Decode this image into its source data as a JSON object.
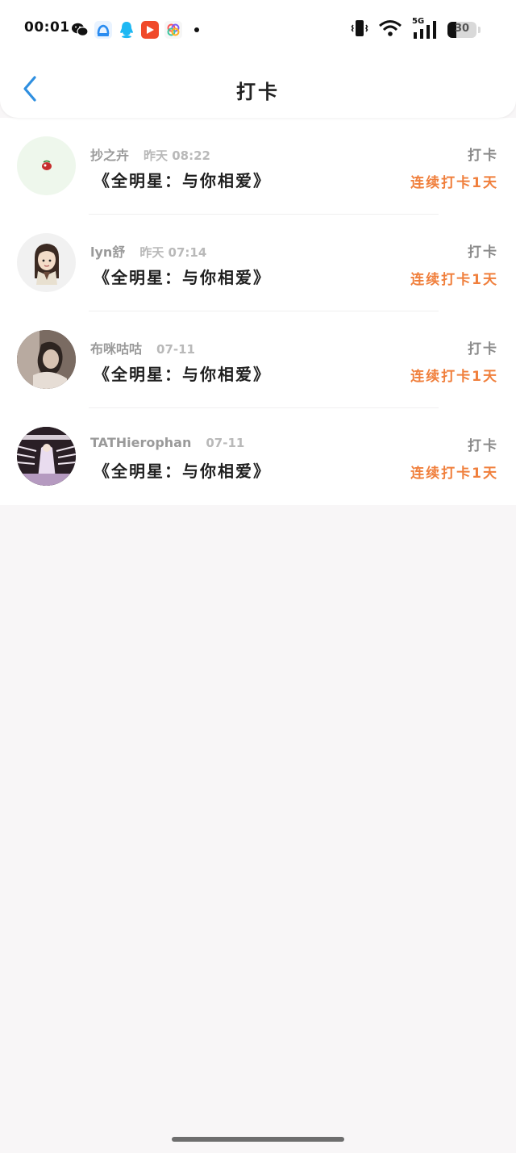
{
  "status_bar": {
    "time": "00:01",
    "apps": [
      "wechat-icon",
      "baidu-netdisk-icon",
      "qq-icon",
      "video-player-icon",
      "photos-app-icon"
    ],
    "network": "5G",
    "battery": "30"
  },
  "nav": {
    "title": "打卡"
  },
  "colors": {
    "accent": "#2f8fe0",
    "streak": "#f07f3c",
    "username": "#9a9a9a"
  },
  "records": [
    {
      "user": "抄之卉",
      "date": "昨天  08:22",
      "title": "《全明星：与你相爱》",
      "action": "打卡",
      "streak": "连续打卡1天"
    },
    {
      "user": "lyn舒",
      "date": "昨天  07:14",
      "title": "《全明星：与你相爱》",
      "action": "打卡",
      "streak": "连续打卡1天"
    },
    {
      "user": "布咪咕咕",
      "date": "07-11",
      "title": "《全明星：与你相爱》",
      "action": "打卡",
      "streak": "连续打卡1天"
    },
    {
      "user": "TATHierophan",
      "date": "07-11",
      "title": "《全明星：与你相爱》",
      "action": "打卡",
      "streak": "连续打卡1天"
    }
  ]
}
